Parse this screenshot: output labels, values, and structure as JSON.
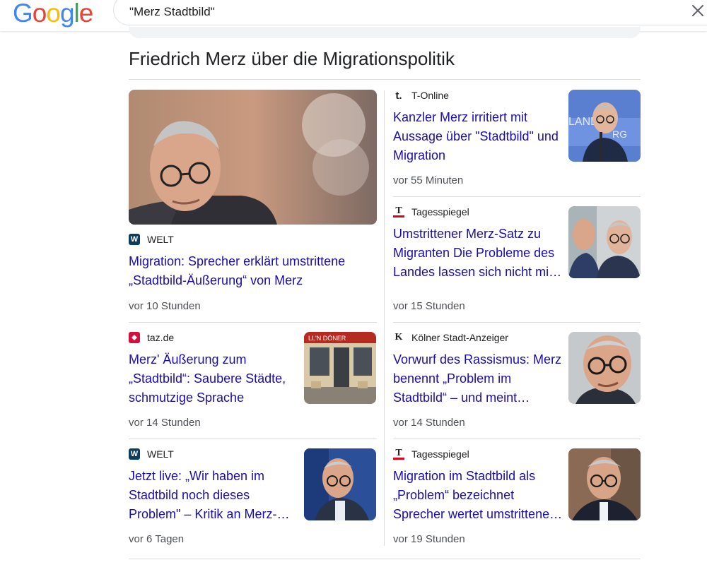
{
  "header": {
    "logo": [
      "G",
      "o",
      "o",
      "g",
      "l",
      "e"
    ],
    "logo_colors": [
      "#4285F4",
      "#EA4335",
      "#FBBC05",
      "#4285F4",
      "#34A853",
      "#EA4335"
    ],
    "search_query": "\"Merz Stadtbild\""
  },
  "section": {
    "title": "Friedrich Merz über die Migrationspolitik"
  },
  "articles": [
    {
      "source": "WELT",
      "favicon_text": "W",
      "favicon_color": "#0c3c60",
      "headline": "Migration: Sprecher erklärt umstrittene „Stadtbild-Äußerung“ von Merz",
      "time": "vor 10 Stunden"
    },
    {
      "source": "T-Online",
      "favicon_text": "t.",
      "headline": "Kanzler Merz irritiert mit Aussage über \"Stadtbild\" und Migration",
      "time": "vor 55 Minuten"
    },
    {
      "source": "Tagesspiegel",
      "favicon_text": "T",
      "headline": "Umstrittener Merz-Satz zu Migranten Die Probleme des Landes lassen sich nicht mi…",
      "time": "vor 15 Stunden"
    },
    {
      "source": "taz.de",
      "favicon_text": "",
      "favicon_color": "#d40f3c",
      "headline": "Merz' Äußerung zum „Stadtbild“: Saubere Städte, schmutzige Sprache",
      "time": "vor 14 Stunden"
    },
    {
      "source": "Kölner Stadt-Anzeiger",
      "favicon_text": "K",
      "headline": "Vorwurf des Rassismus: Merz benennt „Problem im Stadtbild“ – und meint…",
      "time": "vor 14 Stunden"
    },
    {
      "source": "WELT",
      "favicon_text": "W",
      "favicon_color": "#0c3c60",
      "headline": "Jetzt live: „Wir haben im Stadtbild noch dieses Problem\" – Kritik an Merz-…",
      "time": "vor 6 Tagen"
    },
    {
      "source": "Tagesspiegel",
      "favicon_text": "T",
      "headline": "Migration im Stadtbild als „Problem“ bezeichnet Sprecher wertet umstrittene…",
      "time": "vor 19 Stunden"
    }
  ]
}
